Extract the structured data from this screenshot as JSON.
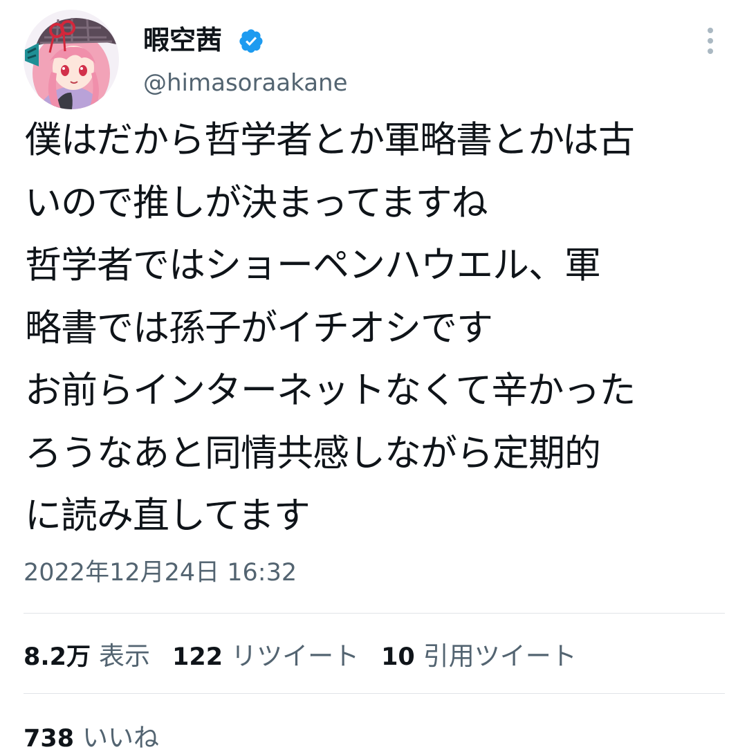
{
  "user": {
    "display_name": "暇空茜",
    "handle": "@himasoraakane",
    "verified": true
  },
  "tweet": {
    "lines": [
      "僕はだから哲学者とか軍略書とかは古",
      "いので推しが決まってますね",
      "哲学者ではショーペンハウエル、軍",
      "略書では孫子がイチオシです",
      "お前らインターネットなくて辛かった",
      "ろうなあと同情共感しながら定期的",
      "に読み直してます"
    ],
    "timestamp": "2022年12月24日 16:32"
  },
  "stats": {
    "views_count": "8.2万",
    "views_label": "表示",
    "retweets_count": "122",
    "retweets_label": "リツイート",
    "quotes_count": "10",
    "quotes_label": "引用ツイート",
    "likes_count": "738",
    "likes_label": "いいね"
  },
  "icons": {
    "verified": "verified-badge-icon",
    "more": "more-vertical-icon"
  },
  "colors": {
    "verified_blue": "#1d9bf0",
    "secondary_text": "#536471",
    "primary_text": "#0f1419",
    "divider": "#e1e4e8"
  }
}
